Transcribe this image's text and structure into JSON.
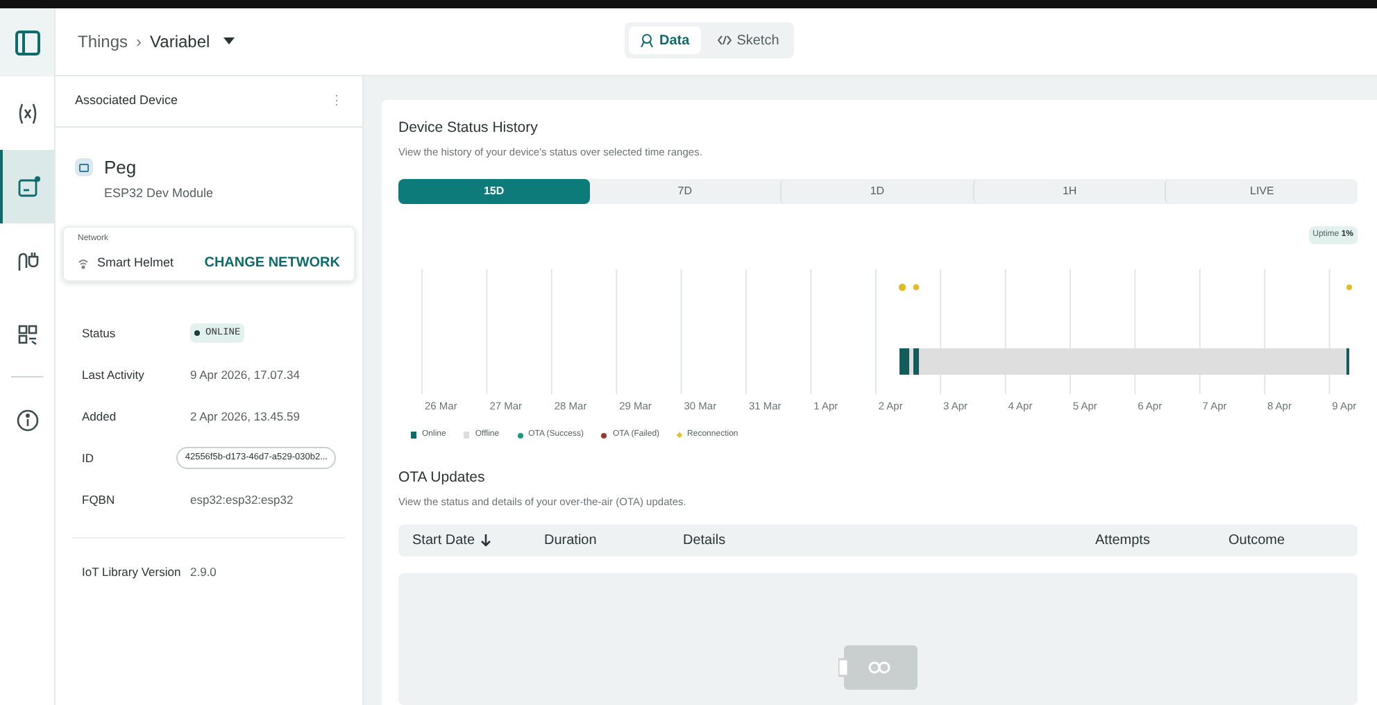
{
  "rail": [
    {
      "kind": "panel",
      "selected": false
    },
    {
      "kind": "variables",
      "selected": false
    },
    {
      "kind": "device",
      "selected": true
    },
    {
      "kind": "plug",
      "selected": false
    },
    {
      "kind": "dashboard",
      "selected": false
    },
    {
      "kind": "info",
      "selected": false
    }
  ],
  "breadcrumb": {
    "root": "Things",
    "separator": "›",
    "current": "Variabel"
  },
  "view_switch": [
    {
      "label": "Data",
      "kind": "data",
      "selected": true
    },
    {
      "label": "Sketch",
      "kind": "code",
      "selected": false
    }
  ],
  "device_panel": {
    "title": "Associated Device",
    "menu": "⋮",
    "device_name": "Peg",
    "device_model": "ESP32 Dev Module",
    "network": {
      "legend": "Network",
      "name": "Smart Helmet",
      "action": "CHANGE NETWORK"
    },
    "details": [
      {
        "label": "Status",
        "value": "ONLINE",
        "kind": "status"
      },
      {
        "label": "Last Activity",
        "value": "9 Apr 2026, 17.07.34",
        "kind": "text"
      },
      {
        "label": "Added",
        "value": "2 Apr 2026, 13.45.59",
        "kind": "text"
      },
      {
        "label": "ID",
        "value": "42556f5b-d173-46d7-a529-030b2...",
        "kind": "pill"
      },
      {
        "label": "FQBN",
        "value": "esp32:esp32:esp32",
        "kind": "text"
      }
    ],
    "library": {
      "label": "IoT Library Version",
      "value": "2.9.0"
    }
  },
  "status_history": {
    "title": "Device Status History",
    "subtitle": "View the history of your device's status over selected time ranges.",
    "ranges": [
      {
        "label": "15D",
        "selected": true
      },
      {
        "label": "7D",
        "selected": false
      },
      {
        "label": "1D",
        "selected": false
      },
      {
        "label": "1H",
        "selected": false
      },
      {
        "label": "LIVE",
        "selected": false
      }
    ],
    "uptime_label": "Uptime",
    "uptime_value": "1%",
    "dates": [
      "26 Mar",
      "27 Mar",
      "28 Mar",
      "29 Mar",
      "30 Mar",
      "31 Mar",
      "1 Apr",
      "2 Apr",
      "3 Apr",
      "4 Apr",
      "5 Apr",
      "6 Apr",
      "7 Apr",
      "8 Apr",
      "9 Apr"
    ],
    "legend": [
      {
        "label": "Online",
        "kind": "square",
        "color": "#0e6b6b"
      },
      {
        "label": "Offline",
        "kind": "square",
        "color": "#dddddd"
      },
      {
        "label": "OTA (Success)",
        "kind": "dot",
        "color": "#1a9a7c"
      },
      {
        "label": "OTA (Failed)",
        "kind": "dot",
        "color": "#9b3a2c"
      },
      {
        "label": "Reconnection",
        "kind": "diamond",
        "color": "#e5c02a"
      }
    ]
  },
  "ota": {
    "title": "OTA Updates",
    "subtitle": "View the status and details of your over-the-air (OTA) updates.",
    "columns": [
      {
        "label": "Start Date",
        "sorted": true
      },
      {
        "label": "Duration",
        "sorted": false
      },
      {
        "label": "Details",
        "sorted": false
      },
      {
        "label": "Attempts",
        "sorted": false
      },
      {
        "label": "Outcome",
        "sorted": false
      }
    ]
  }
}
